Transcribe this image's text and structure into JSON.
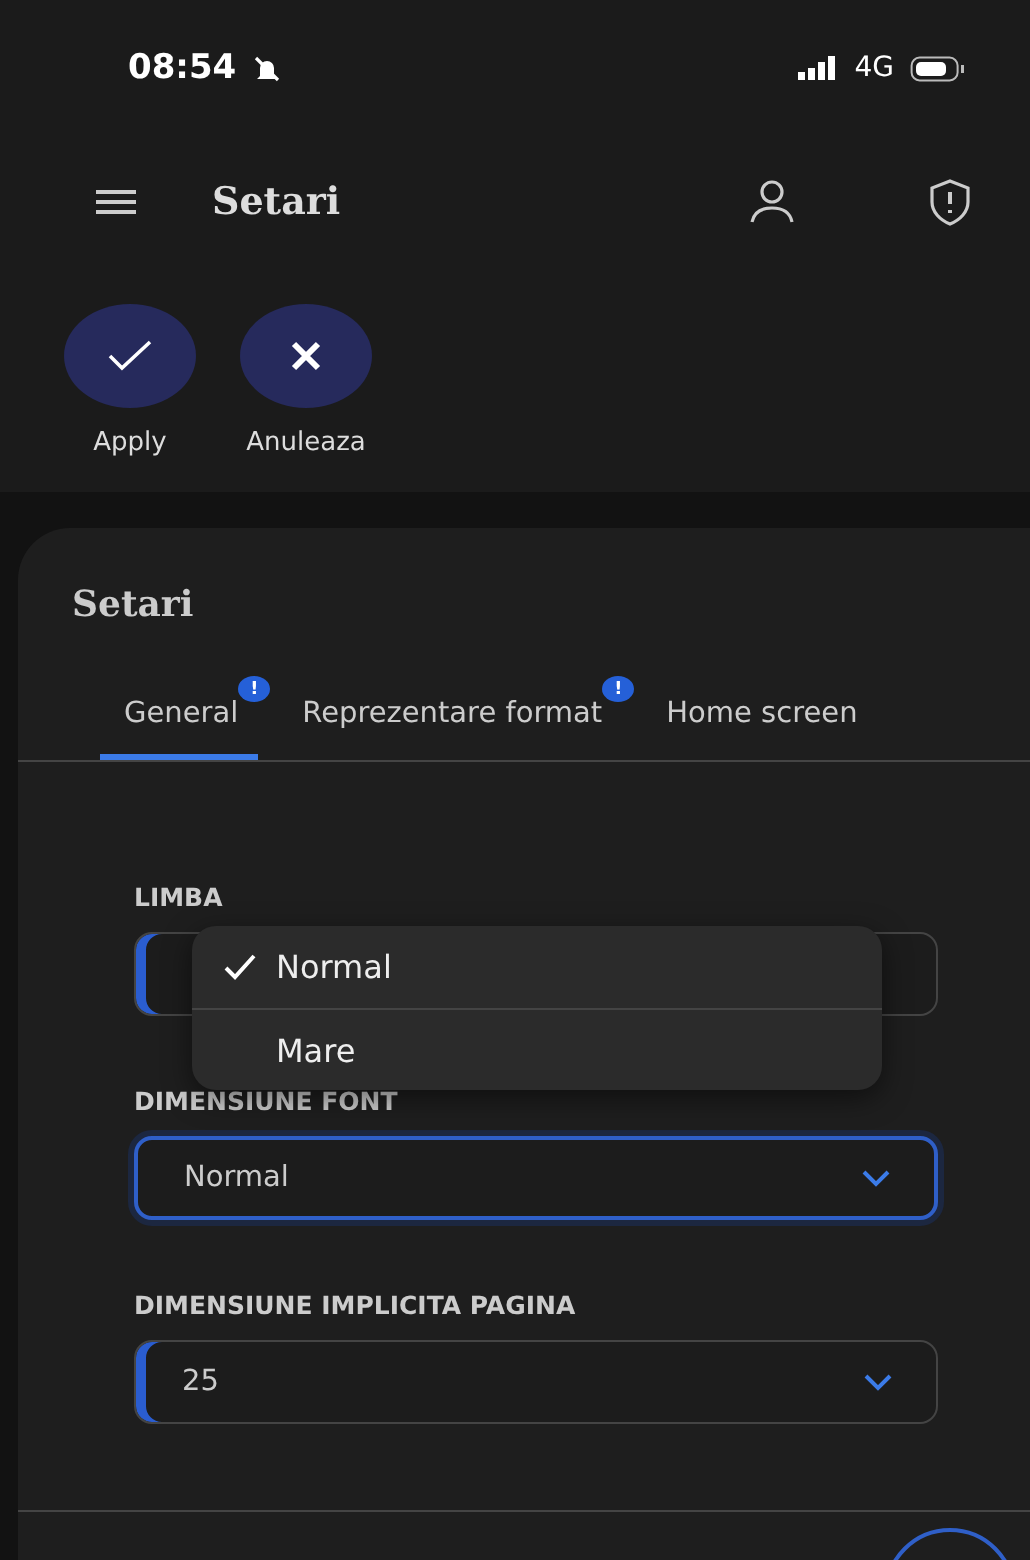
{
  "status_bar": {
    "time": "08:54",
    "network": "4G"
  },
  "app_bar": {
    "title": "Setari"
  },
  "actions": [
    {
      "kind": "check",
      "label": "Apply"
    },
    {
      "kind": "close",
      "label": "Anuleaza"
    }
  ],
  "card": {
    "title": "Setari",
    "tabs": [
      {
        "label": "General",
        "selected": true,
        "badge": "!"
      },
      {
        "label": "Reprezentare format",
        "selected": false,
        "badge": "!"
      },
      {
        "label": "Home screen",
        "selected": false
      }
    ],
    "fields": [
      {
        "label": "LIMBA",
        "focused": false
      },
      {
        "label": "DIMENSIUNE FONT",
        "value": "Normal",
        "focused": true
      },
      {
        "label": "DIMENSIUNE IMPLICITA PAGINA",
        "value": "25",
        "focused": false
      }
    ]
  },
  "menu": {
    "items": [
      {
        "label": "Normal",
        "selected": true
      },
      {
        "label": "Mare",
        "selected": false
      }
    ]
  }
}
